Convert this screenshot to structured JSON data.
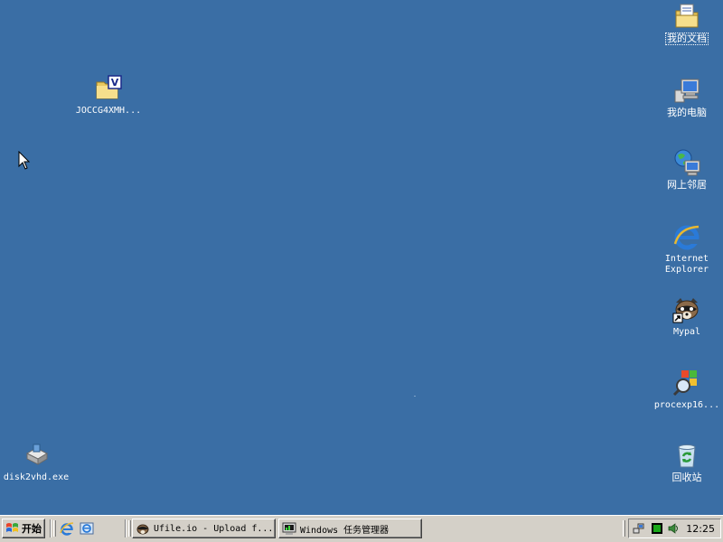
{
  "desktop": {
    "background": "#3a6ea5",
    "icons_left": [
      {
        "label": "JOCCG4XMH...",
        "icon": "folder-icon"
      },
      {
        "label": "disk2vhd.exe",
        "icon": "disk2vhd-icon"
      }
    ],
    "icons_right": [
      {
        "label": "我的文档",
        "icon": "my-documents-icon"
      },
      {
        "label": "我的电脑",
        "icon": "my-computer-icon"
      },
      {
        "label": "网上邻居",
        "icon": "network-places-icon"
      },
      {
        "label": "Internet Explorer",
        "line1": "Internet",
        "line2": "Explorer",
        "icon": "internet-explorer-icon"
      },
      {
        "label": "Mypal",
        "icon": "mypal-icon"
      },
      {
        "label": "procexp16...",
        "icon": "procexp-icon"
      },
      {
        "label": "回收站",
        "icon": "recycle-bin-icon"
      }
    ]
  },
  "taskbar": {
    "start_label": "开始",
    "quick_launch": [
      "internet-explorer-icon",
      "ie-alt-icon"
    ],
    "tasks": [
      {
        "label": "Ufile.io - Upload f...",
        "icon": "mypal-icon"
      },
      {
        "label": "Windows 任务管理器",
        "icon": "task-manager-icon"
      }
    ],
    "tray_icons": [
      "network-icon",
      "cpu-meter-icon",
      "speaker-icon"
    ],
    "clock": "12:25"
  }
}
